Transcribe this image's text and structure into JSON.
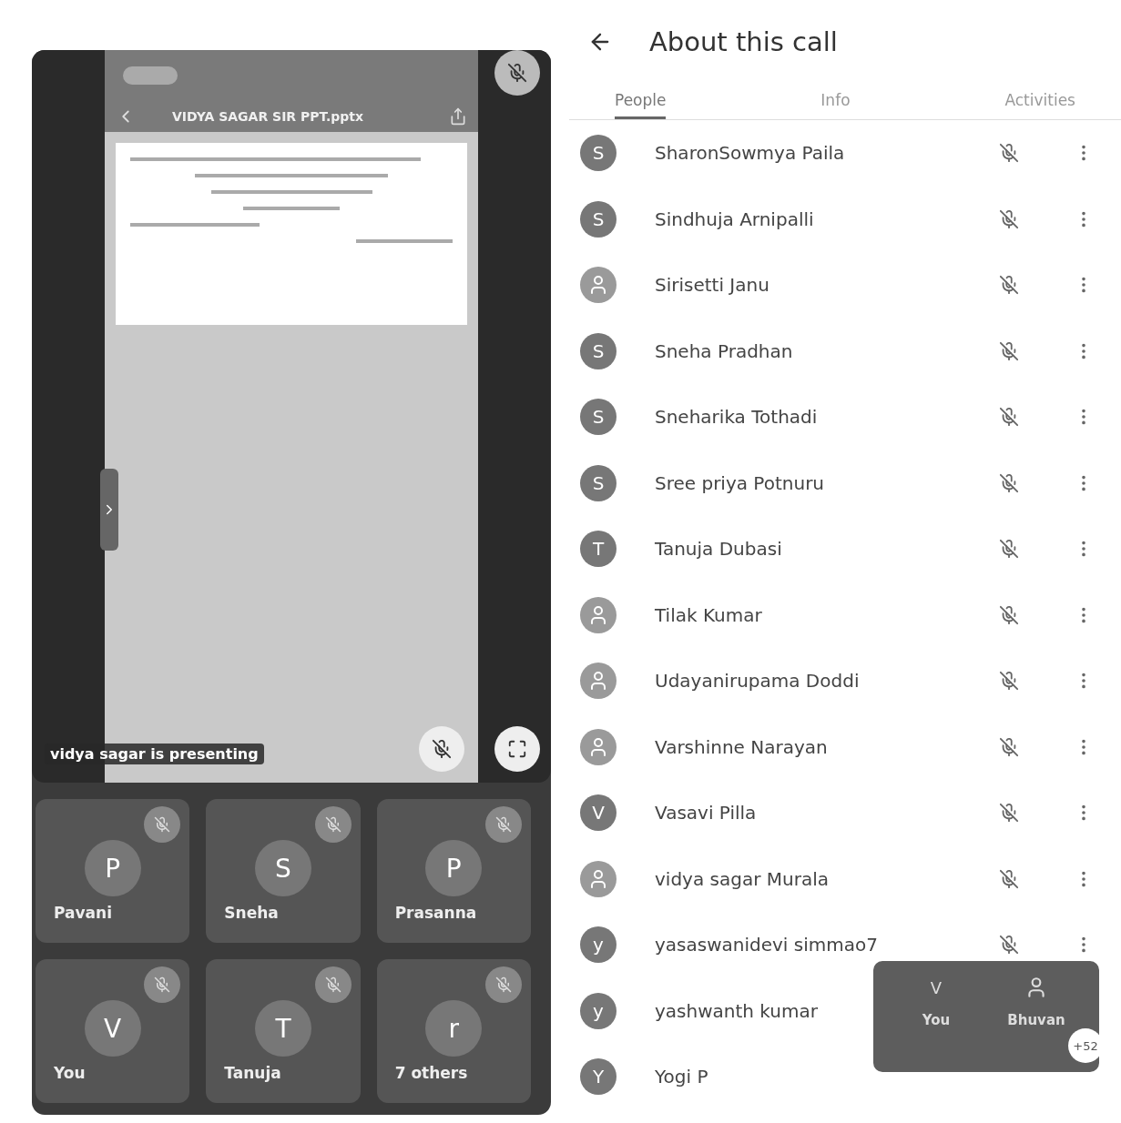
{
  "presentation": {
    "file_title": "VIDYA SAGAR SIR PPT.pptx",
    "caption": "vidya sagar is presenting"
  },
  "tiles": [
    {
      "name": "Pavani",
      "initial": "P",
      "muted": true
    },
    {
      "name": "Sneha",
      "initial": "S",
      "muted": true
    },
    {
      "name": "Prasanna",
      "initial": "P",
      "muted": true
    },
    {
      "name": "You",
      "initial": "V",
      "muted": true
    },
    {
      "name": "Tanuja",
      "initial": "T",
      "muted": true
    },
    {
      "name": "7 others",
      "initial": "r",
      "muted": true
    }
  ],
  "header": {
    "title": "About this call"
  },
  "tabs": [
    {
      "label": "People",
      "selected": true
    },
    {
      "label": "Info",
      "selected": false
    },
    {
      "label": "Activities",
      "selected": false
    }
  ],
  "people": [
    {
      "name": "SharonSowmya Paila",
      "kind": "letter",
      "initial": "S",
      "muted": true
    },
    {
      "name": "Sindhuja Arnipalli",
      "kind": "letter",
      "initial": "S",
      "muted": true
    },
    {
      "name": "Sirisetti Janu",
      "kind": "photo",
      "muted": true
    },
    {
      "name": "Sneha Pradhan",
      "kind": "letter",
      "initial": "S",
      "muted": true
    },
    {
      "name": "Sneharika Tothadi",
      "kind": "letter",
      "initial": "S",
      "muted": true
    },
    {
      "name": "Sree priya Potnuru",
      "kind": "letter",
      "initial": "S",
      "muted": true
    },
    {
      "name": "Tanuja Dubasi",
      "kind": "letter",
      "initial": "T",
      "muted": true
    },
    {
      "name": "Tilak Kumar",
      "kind": "photo",
      "muted": true
    },
    {
      "name": "Udayanirupama Doddi",
      "kind": "photo",
      "muted": true
    },
    {
      "name": "Varshinne Narayan",
      "kind": "photo",
      "muted": true
    },
    {
      "name": "Vasavi Pilla",
      "kind": "letter",
      "initial": "V",
      "muted": true
    },
    {
      "name": "vidya sagar Murala",
      "kind": "photo",
      "muted": true
    },
    {
      "name": "yasaswanidevi simmao7",
      "kind": "letter",
      "initial": "y",
      "muted": true
    },
    {
      "name": "yashwanth kumar",
      "kind": "letter",
      "initial": "y",
      "muted": false
    },
    {
      "name": "Yogi P",
      "kind": "letter",
      "initial": "Y",
      "muted": false
    }
  ],
  "mini_preview": {
    "tiles": [
      {
        "name": "You",
        "initial": "V"
      },
      {
        "name": "Bhuvan"
      }
    ],
    "count": "+52"
  }
}
